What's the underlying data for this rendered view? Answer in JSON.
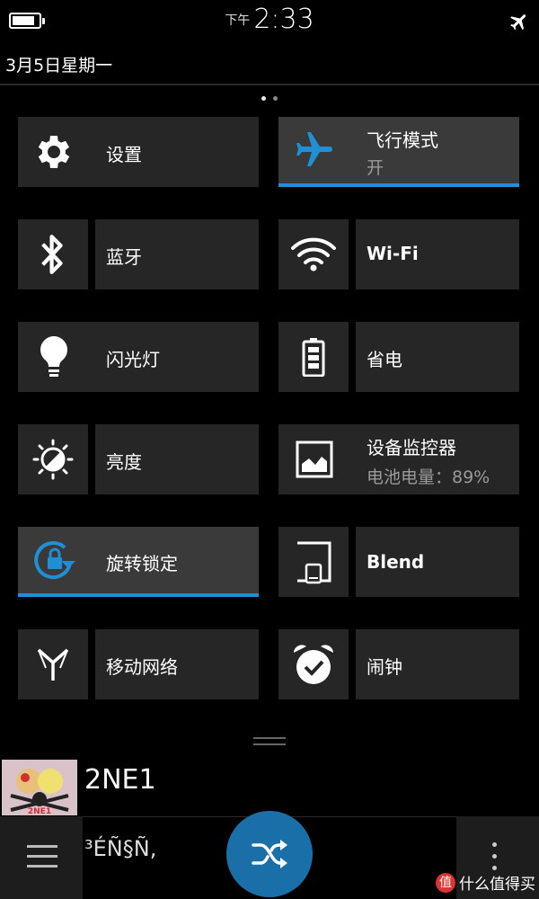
{
  "status_bar": {
    "ampm": "下午",
    "time": "2:33",
    "battery_level": 0.85
  },
  "date": "3月5日星期一",
  "page_indicator": {
    "pages": 2,
    "active": 0
  },
  "tiles": {
    "settings": {
      "label": "设置",
      "icon": "gear-icon"
    },
    "airplane": {
      "label": "飞行模式",
      "state": "开",
      "icon": "airplane-icon",
      "active": true
    },
    "bluetooth": {
      "label": "蓝牙",
      "icon": "bluetooth-icon"
    },
    "wifi": {
      "label": "Wi-Fi",
      "icon": "wifi-icon"
    },
    "flashlight": {
      "label": "闪光灯",
      "icon": "lightbulb-icon"
    },
    "power_saver": {
      "label": "省电",
      "icon": "battery-icon"
    },
    "brightness": {
      "label": "亮度",
      "icon": "brightness-icon"
    },
    "device_monitor": {
      "label": "设备监控器",
      "detail": "电池电量：89%",
      "icon": "monitor-chart-icon"
    },
    "rotation_lock": {
      "label": "旋转锁定",
      "icon": "rotation-lock-icon",
      "active": true
    },
    "blend": {
      "label": "Blend",
      "icon": "blend-icon"
    },
    "mobile_network": {
      "label": "移动网络",
      "icon": "antenna-icon"
    },
    "alarm": {
      "label": "闹钟",
      "icon": "alarm-clock-icon"
    }
  },
  "player": {
    "track_title": "2NE1",
    "subtitle": "³ÉÑ§Ñ,",
    "album_art_text": "2NE1"
  },
  "watermark": {
    "text": "什么值得买",
    "logo": "值"
  },
  "colors": {
    "accent": "#1f8fd6",
    "tile_bg": "#262626",
    "tile_active_bg": "#3a3a3a",
    "shuffle_button": "#1a6fa8"
  }
}
